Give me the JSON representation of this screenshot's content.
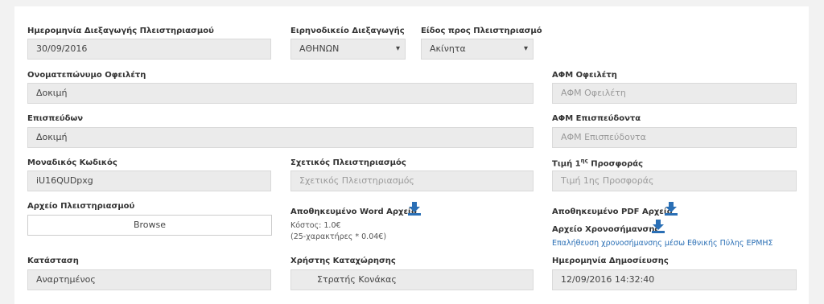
{
  "fields": {
    "auction_date": {
      "label": "Ημερομηνία Διεξαγωγής Πλειστηριασμού",
      "value": "30/09/2016"
    },
    "court": {
      "label": "Ειρηνοδικείο Διεξαγωγής",
      "value": "ΑΘΗΝΩΝ"
    },
    "item_type": {
      "label": "Είδος προς Πλειστηριασμό",
      "value": "Ακίνητα"
    },
    "debtor_name": {
      "label": "Ονοματεπώνυμο Οφειλέτη",
      "value": "Δοκιμή"
    },
    "debtor_afm": {
      "label": "ΑΦΜ Οφειλέτη",
      "placeholder": "ΑΦΜ Οφειλέτη"
    },
    "pursuer": {
      "label": "Επισπεύδων",
      "value": "Δοκιμή"
    },
    "pursuer_afm": {
      "label": "ΑΦΜ Επισπεύδοντα",
      "placeholder": "ΑΦΜ Επισπεύδοντα"
    },
    "unique_code": {
      "label": "Μοναδικός Κωδικός",
      "value": "iU16QUDpxg"
    },
    "related_auction": {
      "label": "Σχετικός Πλειστηριασμός",
      "placeholder": "Σχετικός Πλειστηριασμός"
    },
    "first_offer": {
      "label_prefix": "Τιμή 1",
      "label_sup": "ης",
      "label_suffix": " Προσφοράς",
      "placeholder": "Τιμή 1ης Προσφοράς"
    },
    "auction_file": {
      "label": "Αρχείο Πλειστηριασμού",
      "button": "Browse"
    },
    "word_file": {
      "label": "Αποθηκευμένο Word Αρχείο",
      "cost": "Κόστος: 1.0€",
      "cost_detail": "(25-χαρακτήρες * 0.04€)"
    },
    "pdf_file": {
      "label": "Αποθηκευμένο PDF Αρχείο"
    },
    "timestamp_file": {
      "label": "Αρχείο Χρονοσήμανσης",
      "verify_link": "Επαλήθευση χρονοσήμανσης μέσω Εθνικής Πύλης ΕΡΜΗΣ"
    },
    "status": {
      "label": "Κατάσταση",
      "value": "Αναρτημένος"
    },
    "registrar": {
      "label": "Χρήστης Καταχώρησης",
      "value": "Στρατής Κονάκας"
    },
    "publish_date": {
      "label": "Ημερομηνία Δημοσίευσης",
      "value": "12/09/2016 14:32:40"
    }
  },
  "colors": {
    "accent": "#2a6fb5",
    "input_bg": "#ebebeb"
  },
  "icons": {
    "download": "download-icon"
  }
}
